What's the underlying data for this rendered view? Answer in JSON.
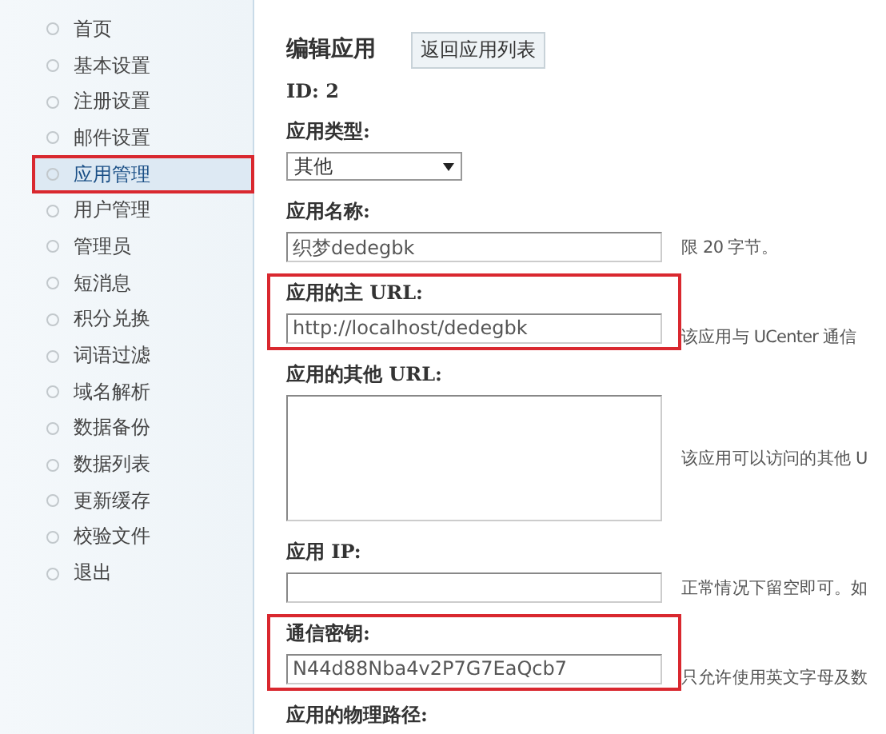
{
  "sidebar": {
    "items": [
      {
        "label": "首页",
        "selected": false,
        "annotated": false
      },
      {
        "label": "基本设置",
        "selected": false,
        "annotated": false
      },
      {
        "label": "注册设置",
        "selected": false,
        "annotated": false
      },
      {
        "label": "邮件设置",
        "selected": false,
        "annotated": false
      },
      {
        "label": "应用管理",
        "selected": true,
        "annotated": true
      },
      {
        "label": "用户管理",
        "selected": false,
        "annotated": false
      },
      {
        "label": "管理员",
        "selected": false,
        "annotated": false
      },
      {
        "label": "短消息",
        "selected": false,
        "annotated": false
      },
      {
        "label": "积分兑换",
        "selected": false,
        "annotated": false
      },
      {
        "label": "词语过滤",
        "selected": false,
        "annotated": false
      },
      {
        "label": "域名解析",
        "selected": false,
        "annotated": false
      },
      {
        "label": "数据备份",
        "selected": false,
        "annotated": false
      },
      {
        "label": "数据列表",
        "selected": false,
        "annotated": false
      },
      {
        "label": "更新缓存",
        "selected": false,
        "annotated": false
      },
      {
        "label": "校验文件",
        "selected": false,
        "annotated": false
      },
      {
        "label": "退出",
        "selected": false,
        "annotated": false
      }
    ]
  },
  "header": {
    "title": "编辑应用",
    "back_button": "返回应用列表"
  },
  "id_line": "ID: 2",
  "fields": [
    {
      "kind": "select",
      "label": "应用类型:",
      "value": "其他",
      "annotated": false
    },
    {
      "kind": "text",
      "label": "应用名称:",
      "value": "织梦dedegbk",
      "hint": "限 20 字节。",
      "annotated": false
    },
    {
      "kind": "text",
      "label": "应用的主 URL:",
      "value": "http://localhost/dedegbk",
      "hint": "该应用与 UCenter 通信",
      "annotated": true
    },
    {
      "kind": "textarea",
      "label": "应用的其他 URL:",
      "hint": "该应用可以访问的其他 U",
      "annotated": false
    },
    {
      "kind": "text",
      "label": "应用 IP:",
      "hint": "正常情况下留空即可。如",
      "annotated": false
    },
    {
      "kind": "text",
      "label": "通信密钥:",
      "value": "N44d88Nba4v2P7G7EaQcb7",
      "hint": "只允许使用英文字母及数",
      "annotated": true
    },
    {
      "kind": "heading",
      "label": "应用的物理路径:",
      "annotated": false
    }
  ]
}
